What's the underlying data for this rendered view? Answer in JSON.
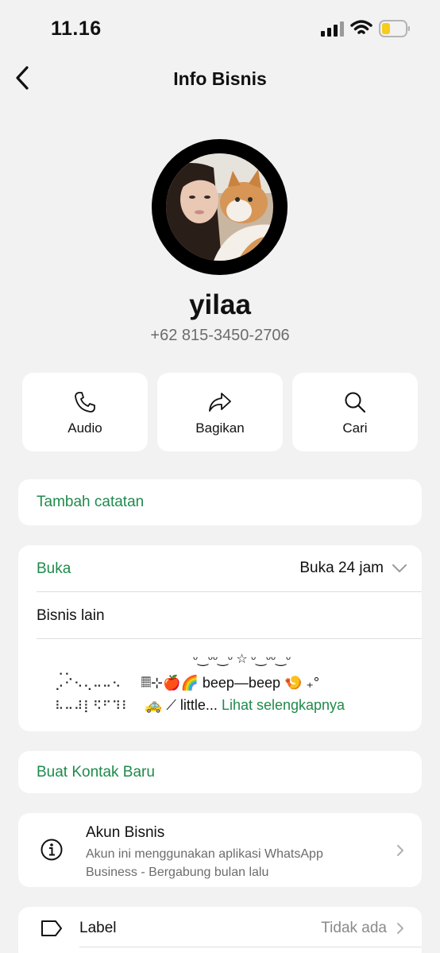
{
  "status_bar": {
    "time": "11.16"
  },
  "nav": {
    "title": "Info Bisnis"
  },
  "profile": {
    "name": "yilaa",
    "phone": "+62 815-3450-2706"
  },
  "actions": [
    {
      "label": "Audio",
      "icon": "phone-icon"
    },
    {
      "label": "Bagikan",
      "icon": "share-icon"
    },
    {
      "label": "Cari",
      "icon": "search-icon"
    }
  ],
  "note": {
    "label": "Tambah catatan"
  },
  "hours": {
    "label": "Buka",
    "value": "Buka 24 jam",
    "other_label": "Bisnis lain",
    "bio_line1": "ᵕ‿ᵕᵕ‿ᵕ  ☆  ᵕ‿ᵕᵕ‿ᵕ",
    "bio_line2a": "⡠⠊⠢⢄⠤⠤⠢",
    "bio_line2b": "𝄜⊹🍎🌈 beep—beep 🍤 ₊°",
    "bio_line3a": "⠧⠤⠼⡇⠫⠋⠹⠇",
    "bio_line3b": "🚕 ⟋ little...",
    "see_more": "Lihat selengkapnya"
  },
  "new_contact": {
    "label": "Buat Kontak Baru"
  },
  "business_account": {
    "title": "Akun Bisnis",
    "description": "Akun ini menggunakan aplikasi WhatsApp Business - Bergabung bulan lalu"
  },
  "label_row": {
    "label": "Label",
    "value": "Tidak ada"
  },
  "colors": {
    "accent": "#1f8a4c",
    "background": "#f2f2f2",
    "card": "#ffffff",
    "secondary_text": "#6c6c6c"
  }
}
